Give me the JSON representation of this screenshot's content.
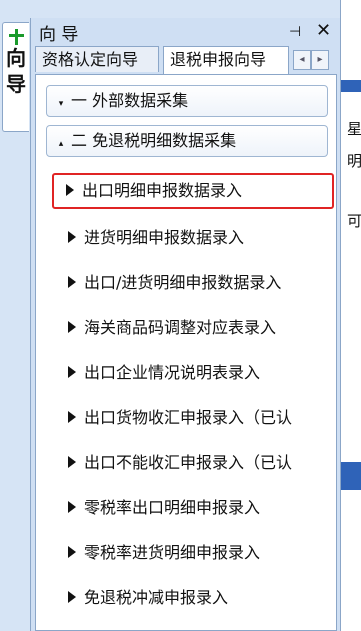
{
  "side_tab": {
    "label_1": "向",
    "label_2": "导"
  },
  "panel": {
    "title": "向 导",
    "pin": "⊣",
    "close": "✕",
    "tabs": [
      "资格认定向导",
      "退税申报向导"
    ],
    "scroll_left": "◂",
    "scroll_right": "▸"
  },
  "groups": [
    {
      "toggle": "▾",
      "label": "一  外部数据采集"
    },
    {
      "toggle": "▴",
      "label": "二  免退税明细数据采集"
    }
  ],
  "items": [
    "出口明细申报数据录入",
    "进货明细申报数据录入",
    "出口/进货明细申报数据录入",
    "海关商品码调整对应表录入",
    "出口企业情况说明表录入",
    "出口货物收汇申报录入（已认",
    "出口不能收汇申报录入（已认",
    "零税率出口明细申报录入",
    "零税率进货明细申报录入",
    "免退税冲减申报录入"
  ],
  "right_glyphs": [
    "星",
    "明",
    "可"
  ],
  "colors": {
    "selected_border": "#e02424",
    "accent": "#2f63b8"
  }
}
